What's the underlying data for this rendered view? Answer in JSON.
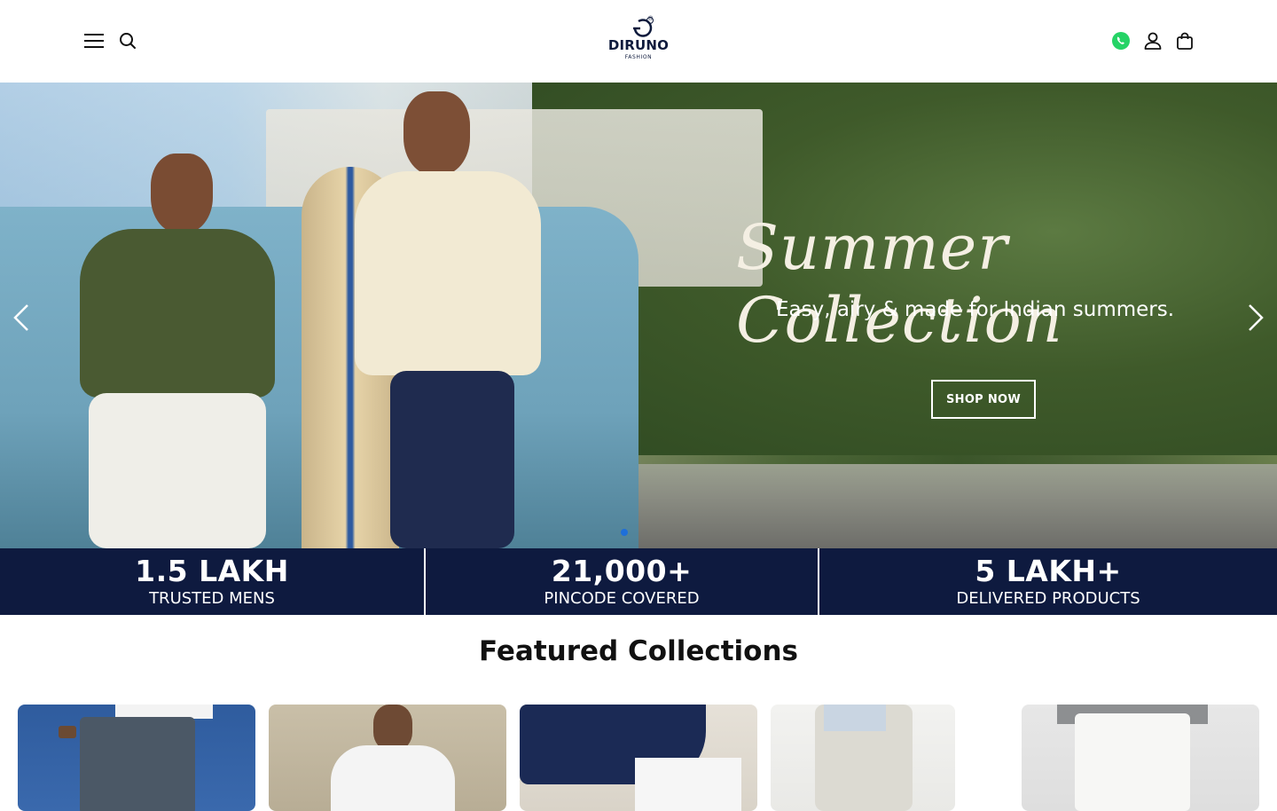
{
  "header": {
    "menu_icon": "hamburger-menu-icon",
    "search_icon": "search-icon",
    "logo": {
      "brand": "DIRUNO",
      "sub": "FASHION",
      "registered": "®"
    },
    "whatsapp_icon": "whatsapp-icon",
    "account_icon": "user-icon",
    "cart_icon": "shopping-bag-icon"
  },
  "hero": {
    "script_title": "Summer Collection",
    "subtitle": "Easy, airy & made for Indian summers.",
    "cta_label": "SHOP NOW",
    "prev_icon": "chevron-left-icon",
    "next_icon": "chevron-right-icon"
  },
  "stats": [
    {
      "value": "1.5 LAKH",
      "label": "TRUSTED MENS"
    },
    {
      "value": "21,000+",
      "label": "PINCODE COVERED"
    },
    {
      "value": "5 LAKH+",
      "label": "DELIVERED PRODUCTS"
    }
  ],
  "featured": {
    "title": "Featured Collections"
  },
  "colors": {
    "navy": "#0e1a3f",
    "accent_blue": "#1e6fd9",
    "whatsapp_green": "#25d366"
  }
}
